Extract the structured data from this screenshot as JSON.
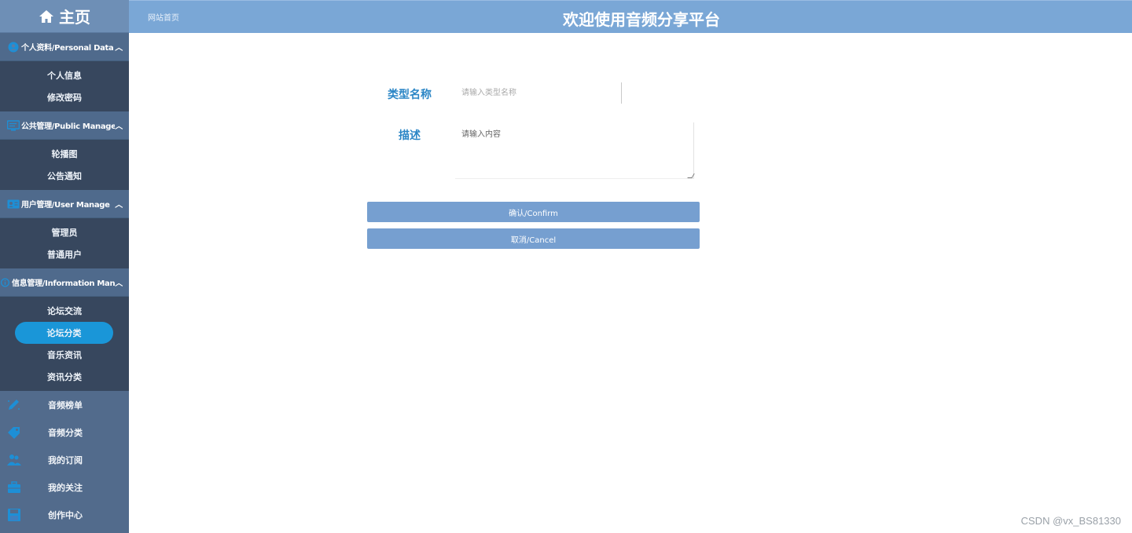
{
  "brand": {
    "title": "主页",
    "icon": "home-icon"
  },
  "header": {
    "site_link": "网站首页",
    "welcome": "欢迎使用音频分享平台"
  },
  "sidebar": {
    "groups": [
      {
        "label": "个人资料/Personal Data",
        "icon": "user-circle-icon",
        "items": [
          {
            "label": "个人信息"
          },
          {
            "label": "修改密码"
          }
        ]
      },
      {
        "label": "公共管理/Public Manage",
        "icon": "monitor-icon",
        "items": [
          {
            "label": "轮播图"
          },
          {
            "label": "公告通知"
          }
        ]
      },
      {
        "label": "用户管理/User Manage",
        "icon": "id-card-icon",
        "items": [
          {
            "label": "管理员"
          },
          {
            "label": "普通用户"
          }
        ]
      },
      {
        "label": "信息管理/Information Manage",
        "icon": "info-icon",
        "items": [
          {
            "label": "论坛交流"
          },
          {
            "label": "论坛分类",
            "active": true
          },
          {
            "label": "音乐资讯"
          },
          {
            "label": "资讯分类"
          }
        ]
      }
    ],
    "plain_items": [
      {
        "label": "音频榜单",
        "icon": "pencil-icon"
      },
      {
        "label": "音频分类",
        "icon": "tag-icon"
      },
      {
        "label": "我的订阅",
        "icon": "users-icon"
      },
      {
        "label": "我的关注",
        "icon": "briefcase-icon"
      },
      {
        "label": "创作中心",
        "icon": "save-icon"
      }
    ],
    "colors": {
      "bg": "#526b8c",
      "sub_bg": "#37475e",
      "active": "#1a96d8",
      "icon": "#1d8fd6"
    }
  },
  "form": {
    "name_label": "类型名称",
    "name_placeholder": "请输入类型名称",
    "desc_label": "描述",
    "desc_placeholder": "请输入内容",
    "confirm_label": "确认/Confirm",
    "cancel_label": "取消/Cancel"
  },
  "watermark": "CSDN @vx_BS81330"
}
